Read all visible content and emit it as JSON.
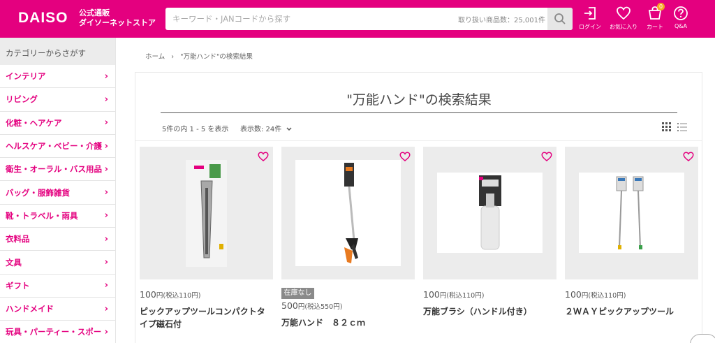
{
  "header": {
    "logo": "DAISO",
    "logo_sub_1": "公式通販",
    "logo_sub_2": "ダイソーネットストア",
    "search_placeholder": "キーワード・JANコードから探す",
    "search_count": "取り扱い商品数：25,001件",
    "login": "ログイン",
    "favorites": "お気に入り",
    "cart": "カート",
    "cart_count": "0",
    "qa": "Q&A",
    "brand_color": "#e4007f"
  },
  "sidebar": {
    "title": "カテゴリーからさがす",
    "items": [
      {
        "label": "インテリア"
      },
      {
        "label": "リビング"
      },
      {
        "label": "化粧・ヘアケア"
      },
      {
        "label": "ヘルスケア・ベビー・介護"
      },
      {
        "label": "衛生・オーラル・バス用品"
      },
      {
        "label": "バッグ・服飾雑貨"
      },
      {
        "label": "靴・トラベル・雨具"
      },
      {
        "label": "衣料品"
      },
      {
        "label": "文具"
      },
      {
        "label": "ギフト"
      },
      {
        "label": "ハンドメイド"
      },
      {
        "label": "玩具・パーティー・スポー"
      }
    ]
  },
  "breadcrumb": {
    "home": "ホーム",
    "sep": "›",
    "current": "\"万能ハンド\"の検索結果"
  },
  "results": {
    "title": "\"万能ハンド\"の検索結果",
    "info": "5件の内 1 - 5 を表示",
    "per_page": "表示数: 24件",
    "products": [
      {
        "price": "100",
        "unit": "円",
        "tax": "(税込110円)",
        "name": "ピックアップツールコンパクトタイプ磁石付",
        "out_of_stock": ""
      },
      {
        "price": "500",
        "unit": "円",
        "tax": "(税込550円)",
        "name": "万能ハンド　８２ｃｍ",
        "out_of_stock": "在庫なし"
      },
      {
        "price": "100",
        "unit": "円",
        "tax": "(税込110円)",
        "name": "万能ブラシ（ハンドル付き）",
        "out_of_stock": ""
      },
      {
        "price": "100",
        "unit": "円",
        "tax": "(税込110円)",
        "name": "２ＷＡＹピックアップツール",
        "out_of_stock": ""
      }
    ]
  }
}
